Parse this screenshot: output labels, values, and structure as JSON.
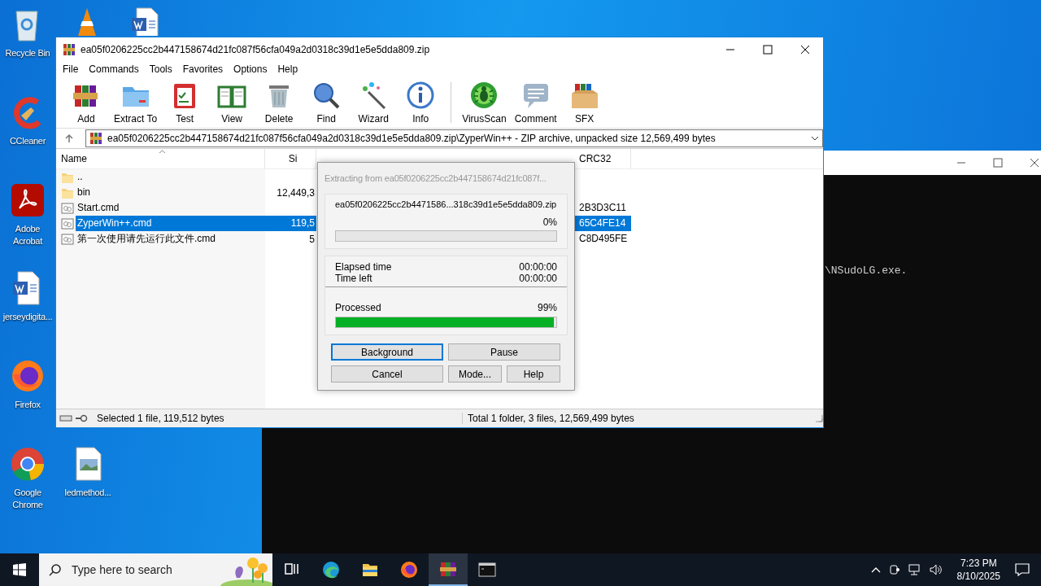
{
  "desktop_icons": [
    {
      "label": "Recycle Bin",
      "kind": "recycle"
    },
    {
      "kind": "vlc"
    },
    {
      "kind": "word"
    },
    {
      "label": "CCleaner",
      "kind": "ccleaner"
    },
    {
      "label": "Adobe Acrobat",
      "kind": "acrobat"
    },
    {
      "label": "jerseydigita...",
      "kind": "word"
    },
    {
      "label": "Firefox",
      "kind": "firefox"
    },
    {
      "label": "Google Chrome",
      "kind": "chrome"
    },
    {
      "label": "ledmethod...",
      "kind": "image"
    }
  ],
  "console": {
    "text": "\\NSudoLG.exe."
  },
  "winrar": {
    "title": "ea05f0206225cc2b447158674d21fc087f56cfa049a2d0318c39d1e5e5dda809.zip",
    "menu": [
      "File",
      "Commands",
      "Tools",
      "Favorites",
      "Options",
      "Help"
    ],
    "toolbar": [
      {
        "label": "Add",
        "kind": "add"
      },
      {
        "label": "Extract To",
        "kind": "extract"
      },
      {
        "label": "Test",
        "kind": "test"
      },
      {
        "label": "View",
        "kind": "view"
      },
      {
        "label": "Delete",
        "kind": "delete"
      },
      {
        "label": "Find",
        "kind": "find"
      },
      {
        "label": "Wizard",
        "kind": "wizard"
      },
      {
        "label": "Info",
        "kind": "info"
      },
      {
        "label": "VirusScan",
        "kind": "virus"
      },
      {
        "label": "Comment",
        "kind": "comment"
      },
      {
        "label": "SFX",
        "kind": "sfx"
      }
    ],
    "address": "ea05f0206225cc2b447158674d21fc087f56cfa049a2d0318c39d1e5e5dda809.zip\\ZyperWin++ - ZIP archive, unpacked size 12,569,499 bytes",
    "columns": {
      "name": "Name",
      "size": "Si",
      "crc": "CRC32"
    },
    "rows": [
      {
        "name": "..",
        "kind": "folder",
        "selected": false
      },
      {
        "name": "bin",
        "kind": "folder",
        "size": "12,449,3",
        "selected": false
      },
      {
        "name": "Start.cmd",
        "kind": "cmd",
        "crc": "2B3D3C11",
        "selected": false
      },
      {
        "name": "ZyperWin++.cmd",
        "kind": "cmd",
        "size": "119,5",
        "crc": "65C4FE14",
        "selected": true
      },
      {
        "name": "第一次使用请先运行此文件.cmd",
        "kind": "cmd",
        "size": "5",
        "crc": "C8D495FE",
        "selected": false
      }
    ],
    "status_left": "Selected 1 file, 119,512 bytes",
    "status_right": "Total 1 folder, 3 files, 12,569,499 bytes"
  },
  "dialog": {
    "title": "Extracting from ea05f0206225cc2b447158674d21fc087f...",
    "archive": "ea05f0206225cc2b4471586...318c39d1e5e5dda809.zip",
    "file_progress": {
      "percent": "0%",
      "level": 0
    },
    "elapsed_label": "Elapsed time",
    "elapsed": "00:00:00",
    "left_label": "Time left",
    "left": "00:00:00",
    "processed_label": "Processed",
    "processed": "99%",
    "level": 0.99,
    "buttons": [
      {
        "label": "Background",
        "focused": true
      },
      {
        "label": "Pause",
        "focused": false
      },
      {
        "label": "Cancel",
        "focused": false
      },
      {
        "label": "Mode...",
        "focused": false
      },
      {
        "label": "Help",
        "focused": false
      }
    ]
  },
  "taskbar": {
    "search_placeholder": "Type here to search",
    "apps": [
      {
        "kind": "taskview",
        "active": false
      },
      {
        "kind": "edge",
        "active": false
      },
      {
        "kind": "explorer",
        "active": false
      },
      {
        "kind": "firefox",
        "active": false
      },
      {
        "kind": "winrar",
        "active": true
      },
      {
        "kind": "console",
        "active": false
      }
    ],
    "time": "7:23 PM",
    "date": "8/10/2025"
  }
}
